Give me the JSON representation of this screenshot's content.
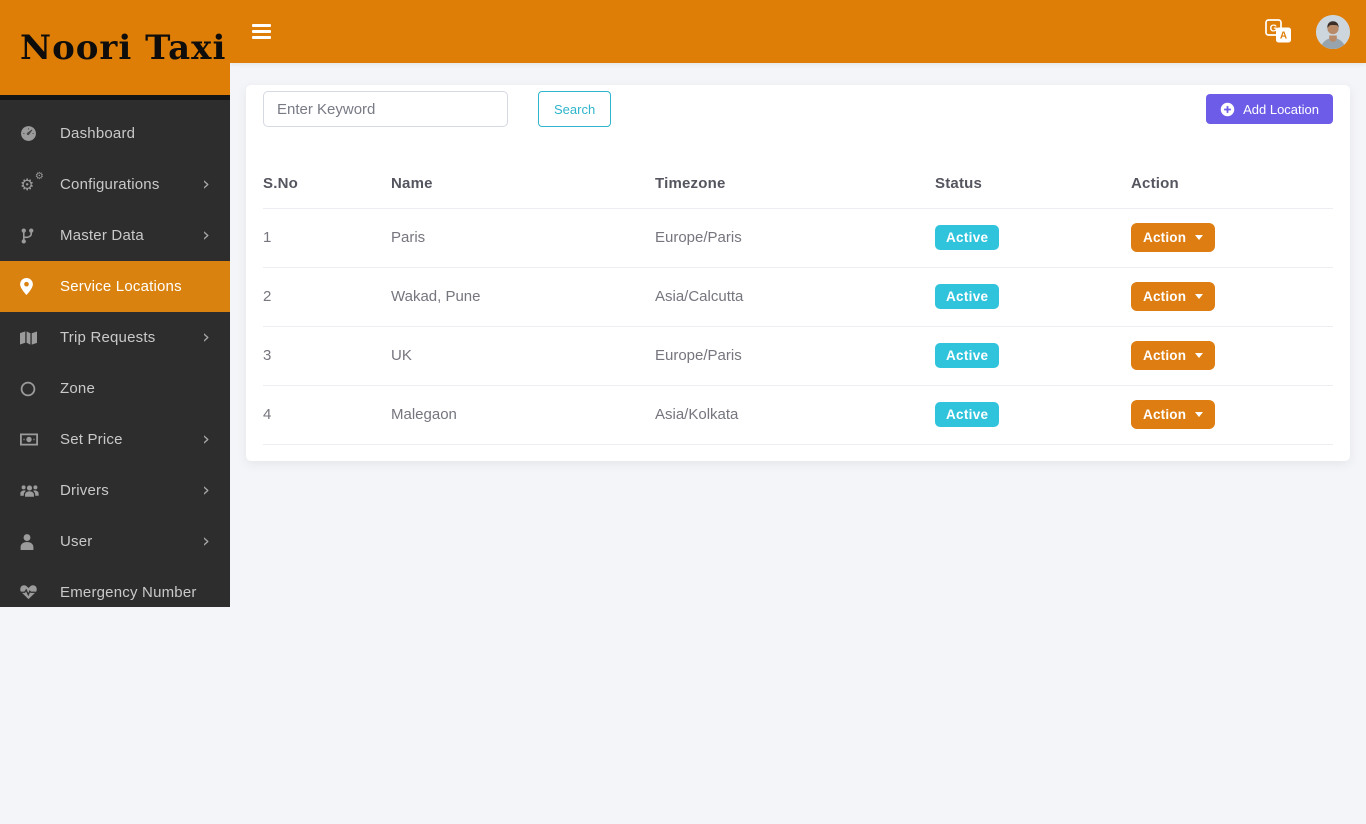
{
  "brand": {
    "name": "Noori Taxi"
  },
  "colors": {
    "orange_primary": "#df7e06",
    "orange_active_item": "#d9820f",
    "orange_action_button": "#de7d11",
    "sidebar_bg": "#2d2d2d",
    "page_bg": "#f4f5f8",
    "badge_cyan": "#2fc3dc",
    "search_cyan": "#2fb5cd",
    "add_button_purple": "#6c5ce7"
  },
  "sidebar": {
    "items": [
      {
        "label": "Dashboard",
        "icon": "dashboard-icon",
        "chevron": false,
        "active": false
      },
      {
        "label": "Configurations",
        "icon": "gears-icon",
        "chevron": true,
        "active": false
      },
      {
        "label": "Master Data",
        "icon": "branch-icon",
        "chevron": true,
        "active": false
      },
      {
        "label": "Service Locations",
        "icon": "map-marker-icon",
        "chevron": false,
        "active": true
      },
      {
        "label": "Trip Requests",
        "icon": "map-icon",
        "chevron": true,
        "active": false
      },
      {
        "label": "Zone",
        "icon": "circle-icon",
        "chevron": false,
        "active": false
      },
      {
        "label": "Set Price",
        "icon": "money-icon",
        "chevron": true,
        "active": false
      },
      {
        "label": "Drivers",
        "icon": "users-icon",
        "chevron": true,
        "active": false
      },
      {
        "label": "User",
        "icon": "user-icon",
        "chevron": true,
        "active": false
      },
      {
        "label": "Emergency Number",
        "icon": "heartbeat-icon",
        "chevron": false,
        "active": false
      }
    ],
    "chevron_glyph": "›"
  },
  "topbar": {
    "icons": [
      "hamburger-icon",
      "translate-icon",
      "user-avatar"
    ]
  },
  "toolbar": {
    "search_placeholder": "Enter Keyword",
    "search_button_label": "Search",
    "add_button_label": "Add Location"
  },
  "table": {
    "headers": [
      "S.No",
      "Name",
      "Timezone",
      "Status",
      "Action"
    ],
    "rows": [
      {
        "sno": "1",
        "name": "Paris",
        "timezone": "Europe/Paris",
        "status": "Active",
        "action": "Action"
      },
      {
        "sno": "2",
        "name": "Wakad, Pune",
        "timezone": "Asia/Calcutta",
        "status": "Active",
        "action": "Action"
      },
      {
        "sno": "3",
        "name": "UK",
        "timezone": "Europe/Paris",
        "status": "Active",
        "action": "Action"
      },
      {
        "sno": "4",
        "name": "Malegaon",
        "timezone": "Asia/Kolkata",
        "status": "Active",
        "action": "Action"
      }
    ]
  }
}
